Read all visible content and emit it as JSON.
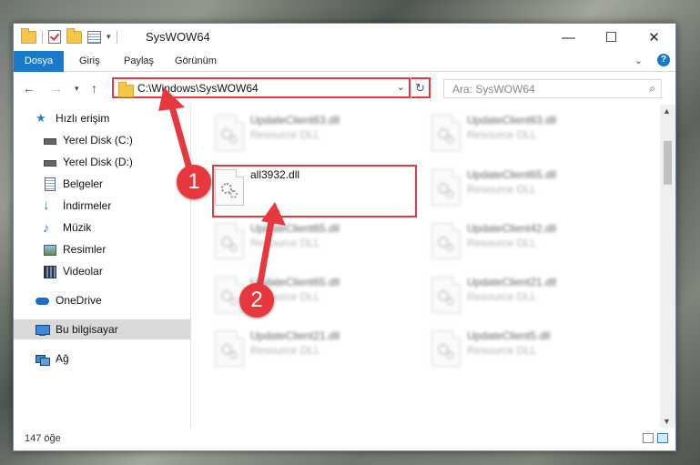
{
  "window": {
    "title": "SysWOW64"
  },
  "ribbon": {
    "tabs": [
      "Dosya",
      "Giriş",
      "Paylaş",
      "Görünüm"
    ]
  },
  "address": {
    "path": "C:\\Windows\\SysWOW64",
    "search_placeholder": "Ara: SysWOW64"
  },
  "sidebar": {
    "items": [
      {
        "label": "Hızlı erişim",
        "icon": "star-icon",
        "color": "#2d7fd0"
      },
      {
        "label": "Yerel Disk (C:)",
        "icon": "drive-icon",
        "pinned": true
      },
      {
        "label": "Yerel Disk (D:)",
        "icon": "drive-icon",
        "pinned": true
      },
      {
        "label": "Belgeler",
        "icon": "document-icon",
        "pinned": true
      },
      {
        "label": "İndirmeler",
        "icon": "download-icon",
        "pinned": true
      },
      {
        "label": "Müzik",
        "icon": "music-icon",
        "pinned": true
      },
      {
        "label": "Resimler",
        "icon": "pictures-icon",
        "pinned": true
      },
      {
        "label": "Videolar",
        "icon": "video-icon",
        "pinned": true
      },
      {
        "label": "OneDrive",
        "icon": "cloud-icon"
      },
      {
        "label": "Bu bilgisayar",
        "icon": "computer-icon",
        "selected": true
      },
      {
        "label": "Ağ",
        "icon": "network-icon"
      }
    ]
  },
  "files": {
    "selected": {
      "name": "all3932.dll"
    },
    "left_column": [
      {
        "name": "UpdateClient63.dll",
        "type": "Resource DLL"
      },
      {
        "name": "UpdateClient65.dll",
        "type": "Resource DLL"
      },
      {
        "name": "UpdateClient65.dll",
        "type": "Resource DLL"
      },
      {
        "name": "UpdateClient21.dll",
        "type": "Resource DLL"
      }
    ],
    "right_column": [
      {
        "name": "UpdateClient63.dll",
        "type": "Resource DLL"
      },
      {
        "name": "UpdateClient65.dll",
        "type": "Resource DLL"
      },
      {
        "name": "UpdateClient42.dll",
        "type": "Resource DLL"
      },
      {
        "name": "UpdateClient21.dll",
        "type": "Resource DLL"
      },
      {
        "name": "UpdateClient5.dll",
        "type": "Resource DLL"
      }
    ]
  },
  "status": {
    "count": "147 öğe"
  },
  "annotations": {
    "step1": "1",
    "step2": "2",
    "color": "#e8383d"
  }
}
